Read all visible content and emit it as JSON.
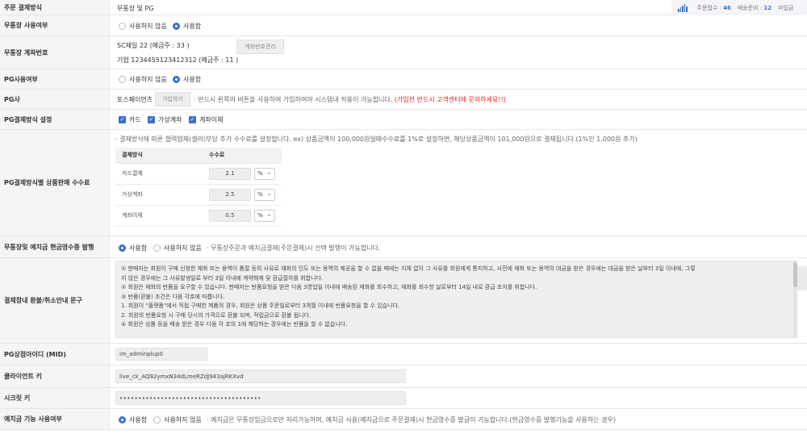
{
  "rows": {
    "order_payment": {
      "label": "주문 결제방식",
      "value": "무통장 및 PG"
    },
    "bank_use": {
      "label": "무통장 사용여부",
      "opt_off": "사용하지 않음",
      "opt_on": "사용함",
      "selected": "on"
    },
    "bank_account": {
      "label": "무통장 계좌번호",
      "line1": "SC제일 22 (예금주 : 33 )",
      "line2": "기업 1234455123412312 (예금주 : 11 )",
      "button": "계좌번호관리"
    },
    "pg_use": {
      "label": "PG사용여부",
      "opt_off": "사용하지 않음",
      "opt_on": "사용함",
      "selected": "on"
    },
    "pg_company": {
      "label": "PG사",
      "name": "토스페이먼츠",
      "join_button": "가입하기",
      "desc": "· 반드시 왼쪽의 버튼을 사용하여 가입하여야 시스템내 적용이 가능합니다.",
      "warn": "(가입전 반드시 고객센터에 문의하세요!!)"
    },
    "pg_methods": {
      "label": "PG결제방식 설정",
      "methods": [
        "카드",
        "가상계좌",
        "계좌이체"
      ]
    },
    "pg_fee": {
      "label": "PG결제방식별 상품판매 수수료",
      "desc": "· 결제방식에 따른 협력업체(셀러)부담 추가 수수료를 설정합니다. ex) 상품금액이 100,000원일때수수료를 1%로 설정하면, 해당상품금액이 101,000원으로 결제됩니다.(1%인 1,000원 추가)",
      "col_method": "결제방식",
      "col_fee": "수수료",
      "items": [
        {
          "method": "카드결제",
          "fee": "2.1",
          "unit": "%"
        },
        {
          "method": "가상계좌",
          "fee": "2.5",
          "unit": "%"
        },
        {
          "method": "계좌이체",
          "fee": "0.5",
          "unit": "%"
        }
      ]
    },
    "cash_receipt": {
      "label": "무통장및 예치금 현금영수증 발행",
      "opt_on": "사용함",
      "opt_off": "사용하지 않음",
      "desc": "· 무통장주문과 예치금결제(주문결제)시 선택 발행이 가능합니다.",
      "selected": "on"
    },
    "refund_notice": {
      "label": "결제창내 환불/취소안내 문구",
      "lines": [
        "① 판매자는 회원이 구매 신청한 재화 또는 용역이 품절 등의 사유로 재화의 인도 또는 용역의 제공을 할 수 없을 때에는 지체 없이 그 사유를 회원에게 통지하고, 사전에 재화 또는 용역의 대금을 받은 경우에는 대금을 받은 날부터 3일 이내에, 그렇",
        "지 않은 경우에는 그 사유발생일로 부터 3일 이내에 계약해제 및 환급절차를 취합니다.",
        "② 회원은 재화의 반품을 요구할 수 있습니다. 판매자는 반품요청을 받은 다음 3영업일 이내에 배송된 재화를 회수하고, 재화를 회수한 날로부터 14일 내로 환급 조치를 취합니다.",
        "③ 반품(환불) 조건은 다음 각호에 따릅니다.",
        "1. 회원이 \"플랫폼\"에서 직접 구매한 제품의 경우, 회원은 상품 주문일로부터 3개월 이내에 반품요청을 할 수 있습니다.",
        "2. 회원의 반품요청 시 구매 당시의 가격으로 환불 되며, 적립금으로 환불 됩니다.",
        "④ 회원은 상품 등을 배송 받은 경우 다음 각 호의 1에 해당하는 경우에는 반품을 할 수 없습니다."
      ]
    },
    "mid": {
      "label": "PG상점아이디 (MID)",
      "value": "im_adminplup0"
    },
    "client_key": {
      "label": "클라이언트 키",
      "value": "live_ck_AQ92ymxN34dLmeRZdJ943ajRKXvd"
    },
    "secret_key": {
      "label": "시크릿 키",
      "value": "••••••••••••••••••••••••••••••••••••••"
    },
    "deposit_use": {
      "label": "예치금 기능 사용여부",
      "opt_on": "사용함",
      "opt_off": "사용하지 않음",
      "desc": "· 예치금은 무통장입금으로만 처리가능하며, 예치금 사용(예치금으로 주문결제)시 현금영수증 발급이 가능합니다.(현금영수증 발행기능을 사용하는 경우)",
      "selected": "on"
    }
  },
  "topstats": {
    "orders_label": "주문접수 :",
    "orders": "46",
    "ready_label": "배송준비 :",
    "ready": "12",
    "unpaid_label": "미입금"
  },
  "colors": {
    "accent": "#3a6fd0",
    "warn": "#e02020",
    "label_bg": "#f5f5f5"
  }
}
